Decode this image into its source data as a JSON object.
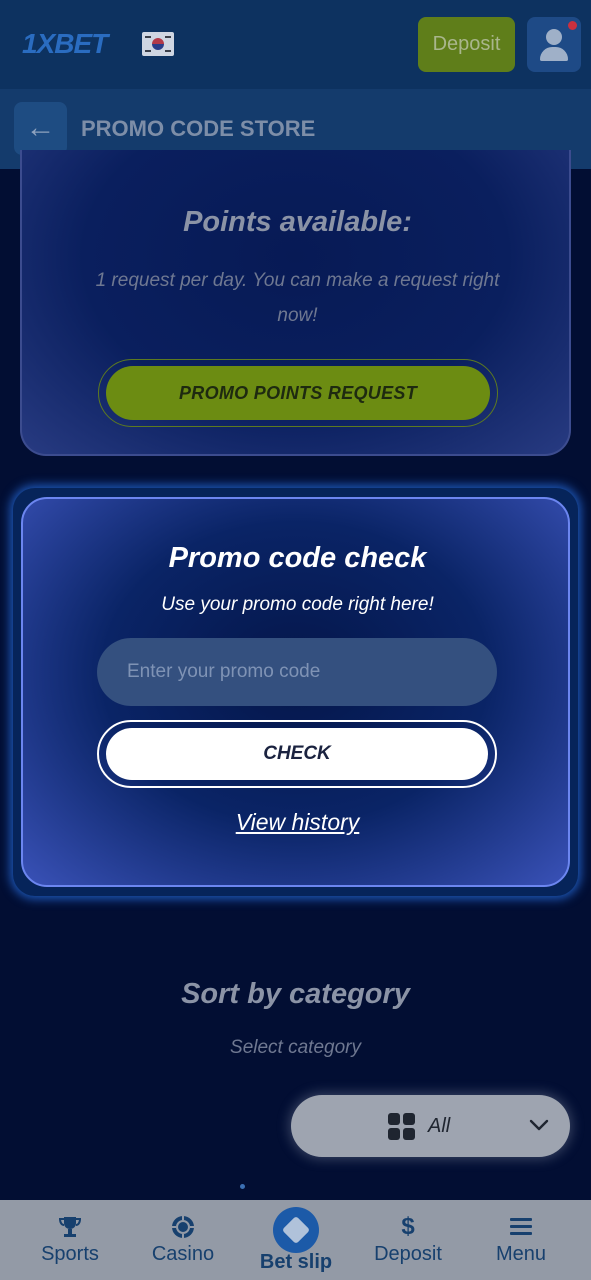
{
  "header": {
    "logo_text": "1XBET",
    "deposit_label": "Deposit",
    "brand_color": "#2a6cc0",
    "deposit_color": "#5f7e1a"
  },
  "subheader": {
    "back_icon": "arrow-left-icon",
    "title": "PROMO CODE STORE"
  },
  "points_card": {
    "title": "Points available:",
    "description": "1 request per day. You can make a request right now!",
    "request_button": "PROMO POINTS REQUEST"
  },
  "promo_check": {
    "title": "Promo code check",
    "subtitle": "Use your promo code right here!",
    "input_placeholder": "Enter your promo code",
    "input_value": "",
    "check_button": "CHECK",
    "history_link": "View history"
  },
  "sort": {
    "title": "Sort by category",
    "subtitle": "Select category",
    "selected": "All"
  },
  "bottom_nav": {
    "items": [
      {
        "label": "Sports",
        "icon": "trophy-icon"
      },
      {
        "label": "Casino",
        "icon": "casino-chip-icon"
      },
      {
        "label": "Bet slip",
        "icon": "ticket-icon"
      },
      {
        "label": "Deposit",
        "icon": "dollar-icon"
      },
      {
        "label": "Menu",
        "icon": "menu-icon"
      }
    ]
  }
}
